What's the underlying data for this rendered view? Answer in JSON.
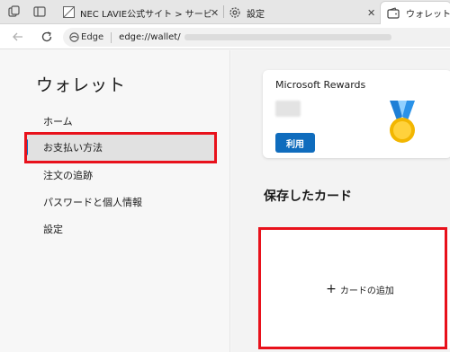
{
  "browser": {
    "tabs": [
      {
        "label": "NEC LAVIE公式サイト > サービス＆サ",
        "close": "✕",
        "icon": "page-icon"
      },
      {
        "label": "設定",
        "close": "✕",
        "icon": "gear-icon"
      },
      {
        "label": "ウォレット",
        "close": "",
        "icon": "wallet-icon"
      }
    ],
    "address": {
      "site_label": "Edge",
      "url": "edge://wallet/"
    }
  },
  "sidebar": {
    "title": "ウォレット",
    "items": [
      {
        "label": "ホーム"
      },
      {
        "label": "お支払い方法"
      },
      {
        "label": "注文の追跡"
      },
      {
        "label": "パスワードと個人情報"
      },
      {
        "label": "設定"
      }
    ]
  },
  "rewards": {
    "title": "Microsoft Rewards",
    "use_label": "利用"
  },
  "saved_cards": {
    "title": "保存したカード",
    "add_label": "カードの追加",
    "add_symbol": "+"
  },
  "colors": {
    "accent": "#0f6cbd",
    "highlight": "#e8111b"
  }
}
